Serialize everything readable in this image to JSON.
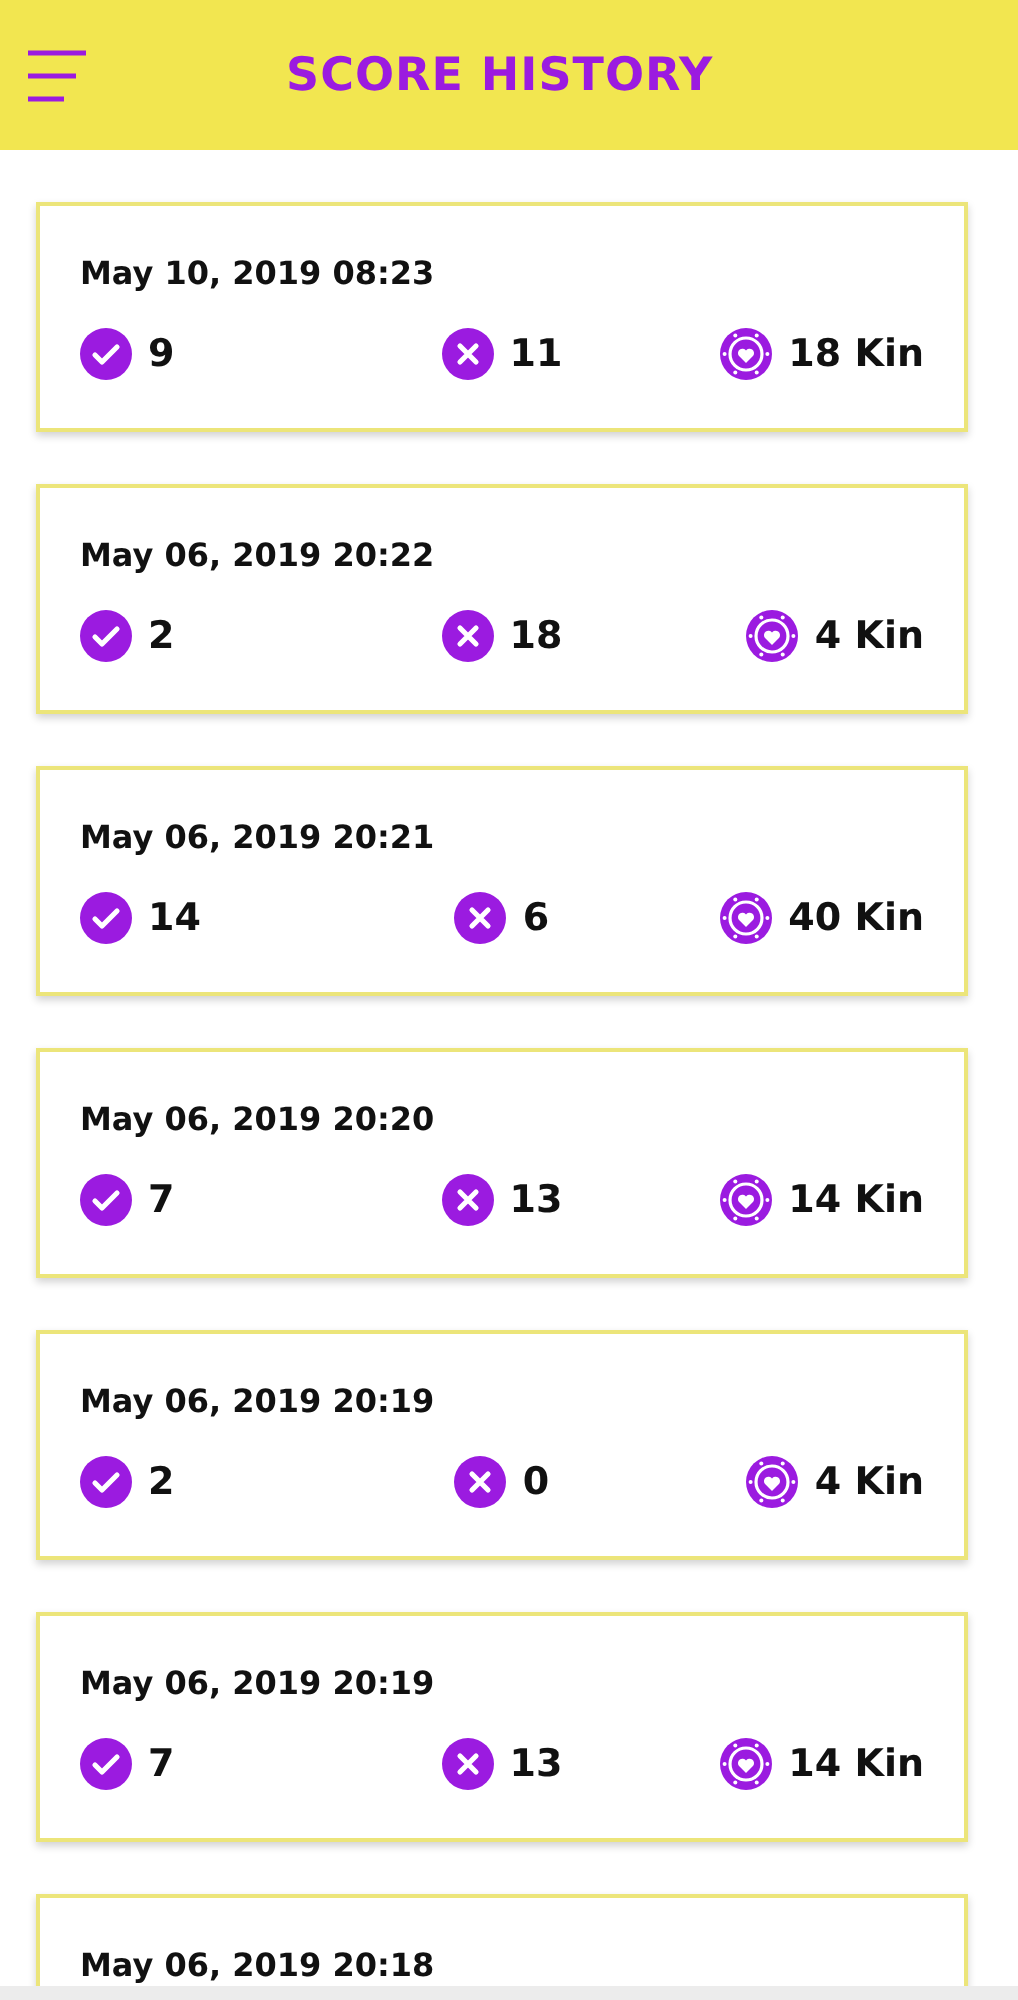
{
  "header": {
    "title": "SCORE HISTORY"
  },
  "entries": [
    {
      "date": "May 10, 2019 08:23",
      "correct": "9",
      "wrong": "11",
      "kin": "18 Kin"
    },
    {
      "date": "May 06, 2019 20:22",
      "correct": "2",
      "wrong": "18",
      "kin": "4 Kin"
    },
    {
      "date": "May 06, 2019 20:21",
      "correct": "14",
      "wrong": "6",
      "kin": "40 Kin"
    },
    {
      "date": "May 06, 2019 20:20",
      "correct": "7",
      "wrong": "13",
      "kin": "14 Kin"
    },
    {
      "date": "May 06, 2019 20:19",
      "correct": "2",
      "wrong": "0",
      "kin": "4 Kin"
    },
    {
      "date": "May 06, 2019 20:19",
      "correct": "7",
      "wrong": "13",
      "kin": "14 Kin"
    },
    {
      "date": "May 06, 2019 20:18"
    }
  ]
}
